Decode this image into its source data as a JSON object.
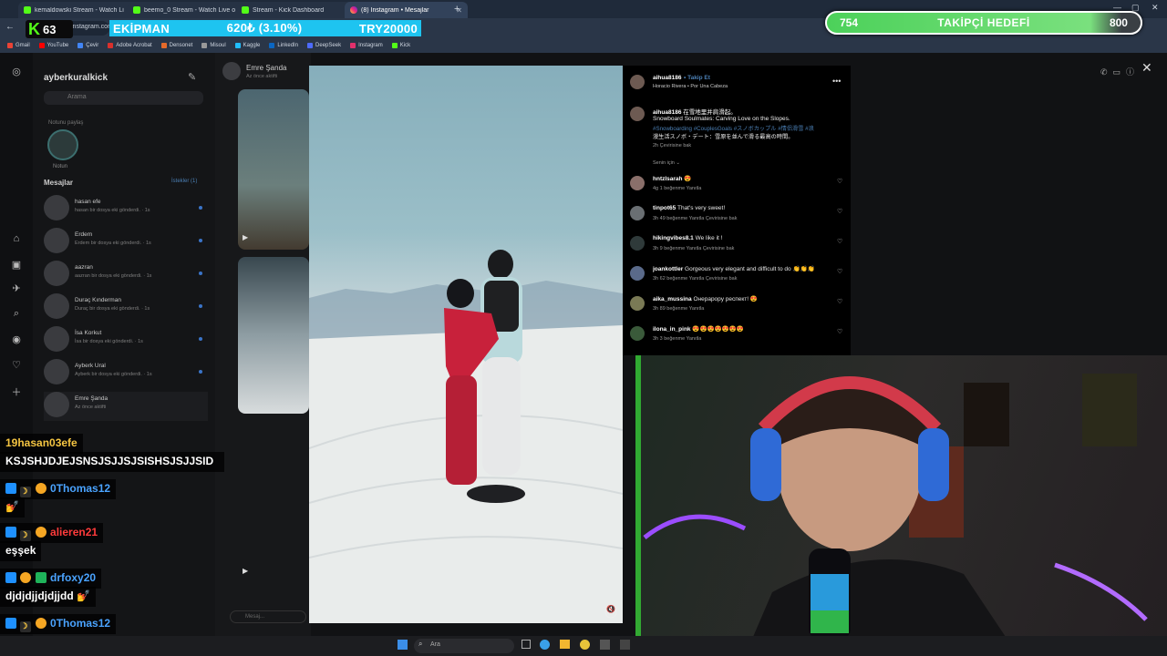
{
  "browser": {
    "tabs": [
      {
        "label": "kemaldowski Stream - Watch Li",
        "icon": "kick-icon"
      },
      {
        "label": "beemo_0 Stream - Watch Live o",
        "icon": "kick-icon"
      },
      {
        "label": "Stream - Kick Dashboard",
        "icon": "kick-icon"
      },
      {
        "label": "(8) Instagram • Mesajlar",
        "icon": "instagram-icon"
      }
    ],
    "url": "instagram.com",
    "bookmarks": [
      "Gmail",
      "YouTube",
      "Çevir",
      "Adobe Acrobat",
      "Densonet",
      "Misoul",
      "Kaggle",
      "LinkedIn",
      "DeepSeek",
      "Instagram",
      "Kick"
    ]
  },
  "overlay": {
    "viewer_count": "63",
    "equipment_label": "EKİPMAN",
    "equipment_amount": "620₺ (3.10%)",
    "equipment_target": "TRY20000",
    "goal_current": "754",
    "goal_label": "TAKİPÇİ HEDEFİ",
    "goal_target": "800",
    "goal_progress": 0.9425
  },
  "instagram": {
    "username": "ayberkuralkick",
    "search_placeholder": "Arama",
    "note_label": "Notunu paylaş",
    "story_name": "Notun",
    "messages_header": "Mesajlar",
    "requests_label": "İstekler (1)",
    "dm_list": [
      {
        "name": "hasan efe",
        "preview": "hasan bir dosya eki gönderdi. · 1s"
      },
      {
        "name": "Erdem",
        "preview": "Erdem bir dosya eki gönderdi. · 1s"
      },
      {
        "name": "aazran",
        "preview": "aazran bir dosya eki gönderdi. · 1s"
      },
      {
        "name": "Duraç Kınderman",
        "preview": "Duraç bir dosya eki gönderdi. · 1s"
      },
      {
        "name": "İsa Korkut",
        "preview": "İsa bir dosya eki gönderdi. · 1s"
      },
      {
        "name": "Ayberk Ural",
        "preview": "Ayberk bir dosya eki gönderdi. · 1s"
      },
      {
        "name": "Emre Şanda",
        "preview": "Az önce aktifti"
      }
    ],
    "chat_title": "Emre Şanda",
    "chat_subtitle": "Az önce aktifti",
    "message_placeholder": "Mesaj..."
  },
  "post": {
    "author": "aihua8186",
    "follow_label": "Takip Et",
    "audio": "Horacio Rivera • Por Una Cabeza",
    "caption_user": "aihua8186",
    "caption_line1": "在雪地里并肩滑起。",
    "caption_line2": "Snowboard Soulmates: Carving Love on the Slopes.",
    "caption_tags1": "#Snowboarding #CouplesGoals #スノボカップル #情侣滑雪 #浪",
    "caption_tags2": "漫生活スノボ・デート：雪原を並んで滑る最高の時間。",
    "caption_meta": "2h   Çevirisine bak",
    "for_you": "Senin için ⌄",
    "comments": [
      {
        "user": "hntzlsarah",
        "text": "😍",
        "meta": "4g   1 beğenme   Yanıtla",
        "avatar": "#8a6f6a"
      },
      {
        "user": "tinpot65",
        "text": "That's very sweet!",
        "meta": "3h   49 beğenme   Yanıtla   Çevirisine bak",
        "avatar": "#6a6f73"
      },
      {
        "user": "hikingvibes8.1",
        "text": "We like it !",
        "meta": "3h   9 beğenme   Yanıtla   Çevirisine bak",
        "avatar": "#2f3a3a"
      },
      {
        "user": "joankottler",
        "text": "Gorgeous very elegant and difficult to do 👏👏👏",
        "meta": "3h   62 beğenme   Yanıtla   Çevirisine bak",
        "avatar": "#5a6a8a"
      },
      {
        "user": "aika_mussina",
        "text": "Онерарору респект! 😍",
        "meta": "3h   89 beğenme   Yanıtla",
        "avatar": "#7a7a55"
      },
      {
        "user": "ilona_in_pink",
        "text": "😍😍😍😍😍😍😍",
        "meta": "3h   3 beğenme   Yanıtla",
        "avatar": "#3a5a3a"
      }
    ]
  },
  "chat": [
    {
      "user": "19hasan03efe",
      "color": "#f5c542",
      "message": "KSJSHJDJEJSNSJSJJSJSISHSJSJJSID"
    },
    {
      "user": "0Thomas12",
      "color": "#4aa3ff",
      "message": "💅"
    },
    {
      "user": "alieren21",
      "color": "#ff3b3b",
      "message": "eşşek"
    },
    {
      "user": "drfoxy20",
      "color": "#4aa3ff",
      "message": "djdjdjjdjdjjdd 💅"
    },
    {
      "user": "0Thomas12",
      "color": "#4aa3ff",
      "message": ""
    }
  ],
  "taskbar": {
    "search_label": "Ara"
  },
  "colors": {
    "kick_green": "#53fc18",
    "instagram_link": "#4b7fb4",
    "goal_fill": "#4cd15a"
  }
}
